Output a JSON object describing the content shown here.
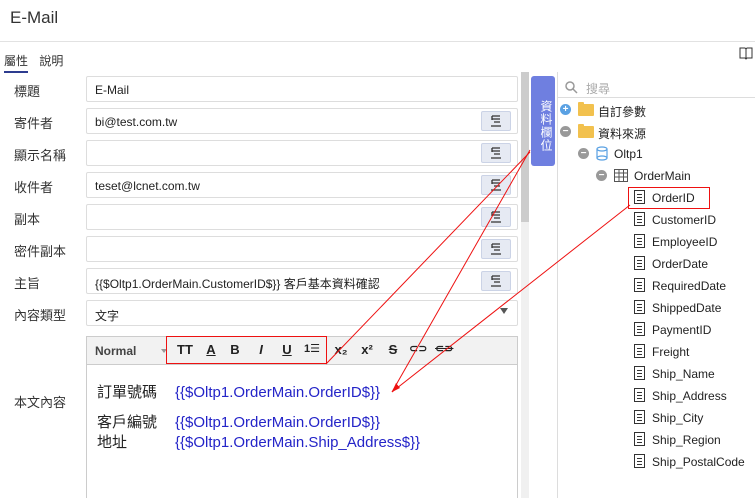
{
  "window": {
    "title": "E-Mail"
  },
  "tabs": [
    {
      "label": "屬性",
      "active": true
    },
    {
      "label": "說明",
      "active": false
    }
  ],
  "form": {
    "rows": [
      {
        "label": "標題",
        "value": "E-Mail",
        "picker": false
      },
      {
        "label": "寄件者",
        "value": "bi@test.com.tw",
        "picker": true
      },
      {
        "label": "顯示名稱",
        "value": "",
        "picker": true
      },
      {
        "label": "收件者",
        "value": "teset@lcnet.com.tw",
        "picker": true
      },
      {
        "label": "副本",
        "value": "",
        "picker": true
      },
      {
        "label": "密件副本",
        "value": "",
        "picker": true
      },
      {
        "label": "主旨",
        "value": "{{$Oltp1.OrderMain.CustomerID$}} 客戶基本資料確認",
        "picker": true
      },
      {
        "label": "內容類型",
        "value": "文字",
        "picker": false,
        "select": true
      }
    ],
    "editor_label": "本文內容"
  },
  "editor": {
    "format_select": "Normal",
    "toolbar_icons": [
      "font-size-icon",
      "font-color-icon",
      "bold-icon",
      "italic-icon",
      "underline-icon",
      "ordered-list-icon",
      "subscript-icon",
      "superscript-icon",
      "strikethrough-icon",
      "link-icon",
      "unlink-icon"
    ],
    "lines": [
      {
        "key": "訂單號碼",
        "value": "{{$Oltp1.OrderMain.OrderID$}}"
      },
      {
        "key": "客戶編號",
        "value": "{{$Oltp1.OrderMain.OrderID$}}"
      },
      {
        "key": "地址",
        "value": "{{$Oltp1.OrderMain.Ship_Address$}}"
      }
    ]
  },
  "side_tab": {
    "label": "資料欄位"
  },
  "tree": {
    "search_placeholder": "搜尋",
    "nodes": [
      {
        "label": "自訂參數",
        "type": "folder",
        "toggle": "plus"
      },
      {
        "label": "資料來源",
        "type": "folder",
        "toggle": "minus"
      },
      {
        "label": "Oltp1",
        "type": "database",
        "toggle": "minus"
      },
      {
        "label": "OrderMain",
        "type": "table",
        "toggle": "minus"
      },
      {
        "label": "OrderID",
        "type": "field",
        "highlighted": true
      },
      {
        "label": "CustomerID",
        "type": "field"
      },
      {
        "label": "EmployeeID",
        "type": "field"
      },
      {
        "label": "OrderDate",
        "type": "field"
      },
      {
        "label": "RequiredDate",
        "type": "field"
      },
      {
        "label": "ShippedDate",
        "type": "field"
      },
      {
        "label": "PaymentID",
        "type": "field"
      },
      {
        "label": "Freight",
        "type": "field"
      },
      {
        "label": "Ship_Name",
        "type": "field"
      },
      {
        "label": "Ship_Address",
        "type": "field"
      },
      {
        "label": "Ship_City",
        "type": "field"
      },
      {
        "label": "Ship_Region",
        "type": "field"
      },
      {
        "label": "Ship_PostalCode",
        "type": "field"
      }
    ]
  },
  "colors": {
    "accent": "#6f7fe0",
    "link_text": "#2424c8",
    "highlight": "#e11111"
  }
}
